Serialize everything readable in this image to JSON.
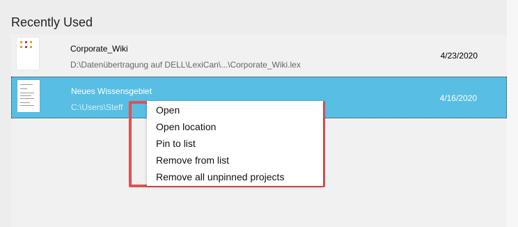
{
  "header": {
    "title": "Recently Used"
  },
  "recent": [
    {
      "name": "Corporate_Wiki",
      "path": "D:\\Datenübertragung auf DELL\\LexiCan\\...\\Corporate_Wiki.lex",
      "date": "4/23/2020"
    },
    {
      "name": "Neues Wissensgebiet",
      "path": "C:\\Users\\Steff",
      "date": "4/16/2020"
    }
  ],
  "context_menu": {
    "items": [
      "Open",
      "Open location",
      "Pin to list",
      "Remove from list",
      "Remove all unpinned projects"
    ]
  },
  "colors": {
    "selection": "#58bee4",
    "highlight_outline": "#e25050"
  },
  "icons": [
    "document-thumbnail-icon"
  ]
}
